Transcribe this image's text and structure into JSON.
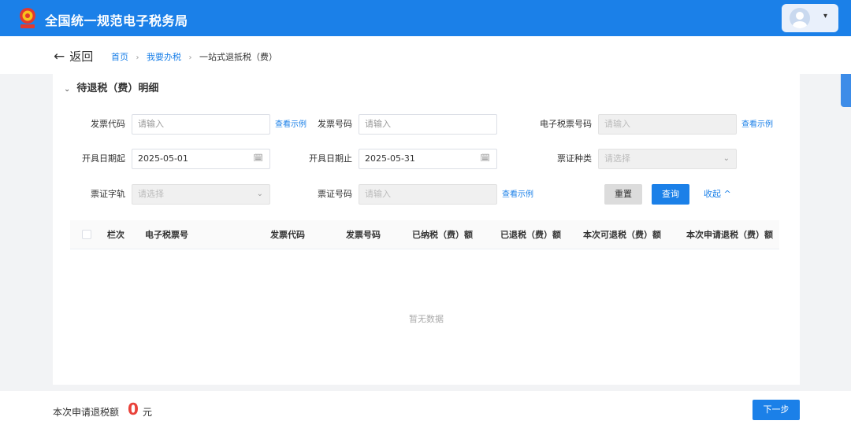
{
  "header": {
    "title": "全国统一规范电子税务局",
    "user_caret": "▾"
  },
  "nav": {
    "back_arrow": "←",
    "back_label": "返回",
    "crumbs": [
      "首页",
      "我要办税",
      "一站式退抵税（费）"
    ],
    "crumb_sep": "›"
  },
  "section": {
    "chevron": "⌄",
    "title": "待退税（费）明细"
  },
  "form": {
    "invoice_code": {
      "label": "发票代码",
      "placeholder": "请输入"
    },
    "invoice_no": {
      "label": "发票号码",
      "placeholder": "请输入"
    },
    "e_ticket_no": {
      "label": "电子税票号码",
      "placeholder": "请输入"
    },
    "date_start": {
      "label": "开具日期起",
      "value": "2025-05-01"
    },
    "date_end": {
      "label": "开具日期止",
      "value": "2025-05-31"
    },
    "ticket_type": {
      "label": "票证种类",
      "placeholder": "请选择"
    },
    "ticket_word": {
      "label": "票证字轨",
      "placeholder": "请选择"
    },
    "ticket_no": {
      "label": "票证号码",
      "placeholder": "请输入"
    },
    "example_link": "查看示例",
    "reset": "重置",
    "query": "查询",
    "collapse": "收起",
    "collapse_icon": "^"
  },
  "table": {
    "columns": [
      "栏次",
      "电子税票号",
      "发票代码",
      "发票号码",
      "已纳税（费）额",
      "已退税（费）额",
      "本次可退税（费）额",
      "本次申请退税（费）额"
    ],
    "rows": [],
    "empty_text": "暂无数据"
  },
  "footer": {
    "label": "本次申请退税额",
    "amount": "0",
    "unit": "元",
    "next": "下一步"
  },
  "colors": {
    "primary": "#1b80e8",
    "amount": "#e9423a"
  }
}
